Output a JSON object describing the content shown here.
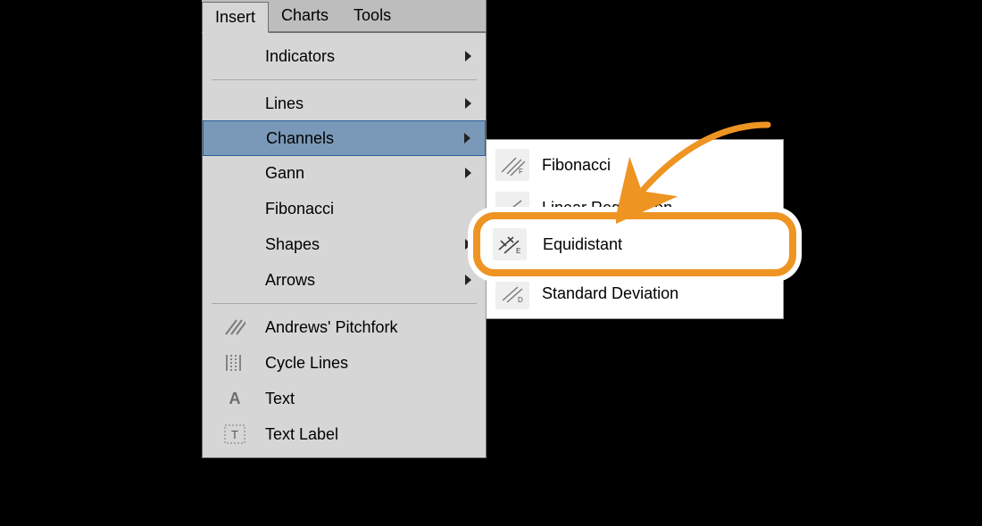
{
  "menubar": {
    "tabs": [
      {
        "label": "Insert",
        "active": true
      },
      {
        "label": "Charts",
        "active": false
      },
      {
        "label": "Tools",
        "active": false
      }
    ]
  },
  "dropdown": {
    "groups": [
      [
        {
          "label": "Indicators",
          "submenu": true,
          "icon": null
        }
      ],
      [
        {
          "label": "Lines",
          "submenu": true,
          "icon": null
        },
        {
          "label": "Channels",
          "submenu": true,
          "icon": null,
          "selected": true
        },
        {
          "label": "Gann",
          "submenu": true,
          "icon": null
        },
        {
          "label": "Fibonacci",
          "submenu": false,
          "icon": null
        },
        {
          "label": "Shapes",
          "submenu": true,
          "icon": null
        },
        {
          "label": "Arrows",
          "submenu": true,
          "icon": null
        }
      ],
      [
        {
          "label": "Andrews' Pitchfork",
          "submenu": false,
          "icon": "diag-lines"
        },
        {
          "label": "Cycle Lines",
          "submenu": false,
          "icon": "vert-lines"
        },
        {
          "label": "Text",
          "submenu": false,
          "icon": "letter-a"
        },
        {
          "label": "Text Label",
          "submenu": false,
          "icon": "boxed-t"
        }
      ]
    ]
  },
  "submenu": {
    "items": [
      {
        "label": "Fibonacci",
        "icon": "diag-f"
      },
      {
        "label": "Linear Regression",
        "icon": "diag-l"
      },
      {
        "label": "Equidistant",
        "icon": "diag-e",
        "highlighted": true
      },
      {
        "label": "Standard Deviation",
        "icon": "diag-d"
      }
    ]
  },
  "annotation": {
    "highlight_color": "#ee9423",
    "arrow_color": "#ee9423"
  }
}
